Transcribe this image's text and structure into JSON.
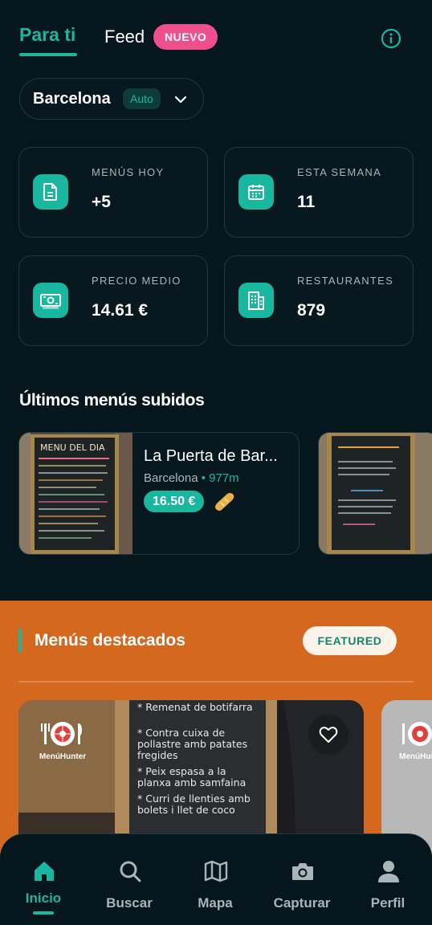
{
  "header": {
    "tab_active": "Para ti",
    "tab_feed": "Feed",
    "new_badge": "NUEVO"
  },
  "city_selector": {
    "city": "Barcelona",
    "mode": "Auto"
  },
  "stats": [
    {
      "label": "MENÚS HOY",
      "value": "+5",
      "icon": "document-icon"
    },
    {
      "label": "ESTA SEMANA",
      "value": "11",
      "icon": "calendar-icon"
    },
    {
      "label": "PRECIO MEDIO",
      "value": "14.61 €",
      "icon": "money-icon"
    },
    {
      "label": "RESTAURANTES",
      "value": "879",
      "icon": "building-icon"
    }
  ],
  "latest": {
    "title": "Últimos menús subidos",
    "items": [
      {
        "name": "La Puerta de Bar...",
        "city": "Barcelona",
        "distance": "• 977m",
        "price": "16.50 €"
      }
    ]
  },
  "featured": {
    "title": "Menús destacados",
    "badge": "FEATURED",
    "card_brand": "MenúHunter",
    "card_brand_partial": "MenúHun",
    "board_lines": [
      "* Remenat de botifarra",
      "* Contra cuixa de",
      "pollastre amb patates",
      "fregides",
      "* Peix espasa a la",
      "planxa amb samfaina",
      "* Curri de llenties amb",
      "bolets i llet de coco"
    ]
  },
  "nav": [
    {
      "label": "Inicio",
      "icon": "home-icon",
      "active": true
    },
    {
      "label": "Buscar",
      "icon": "search-icon",
      "active": false
    },
    {
      "label": "Mapa",
      "icon": "map-icon",
      "active": false
    },
    {
      "label": "Capturar",
      "icon": "camera-icon",
      "active": false
    },
    {
      "label": "Perfil",
      "icon": "user-icon",
      "active": false
    }
  ],
  "colors": {
    "background": "#06161d",
    "accent": "#19b79f",
    "badge_pink": "#ef4f8d",
    "featured_bg": "#d4681e"
  }
}
